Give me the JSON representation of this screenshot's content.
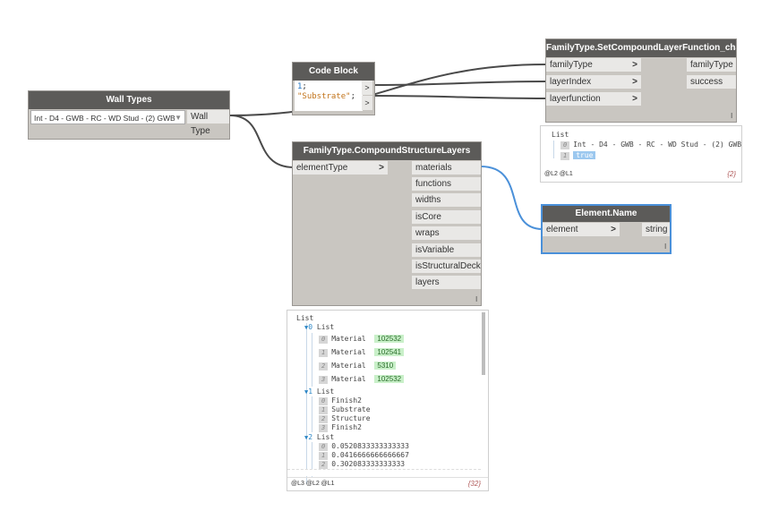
{
  "wall_types": {
    "title": "Wall Types",
    "selected": "Int - D4 - GWB - RC - WD Stud - (2) GWB",
    "output": "Wall Type"
  },
  "code_block": {
    "title": "Code Block",
    "line1": "1",
    "line1_end": ";",
    "line2": "\"Substrate\"",
    "line2_end": ";",
    "out": ">"
  },
  "set_layer_fn": {
    "title": "FamilyType.SetCompoundLayerFunction_chad",
    "inputs": [
      "familyType",
      "layerIndex",
      "layerfunction"
    ],
    "outputs": [
      "familyType",
      "success"
    ],
    "chevron": ">",
    "lacing": "l",
    "preview": {
      "header": "List",
      "row0_idx": "0",
      "row0_text": "Int - D4 - GWB - RC - WD Stud - (2) GWB",
      "row1_idx": "1",
      "row1_text": "true",
      "levels": "@L2 @L1",
      "count": "{2}"
    }
  },
  "compound_layers": {
    "title": "FamilyType.CompoundStructureLayers",
    "input": "elementType",
    "chevron": ">",
    "outputs": [
      "materials",
      "functions",
      "widths",
      "isCore",
      "wraps",
      "isVariable",
      "isStructuralDeck",
      "layers"
    ],
    "lacing": "l"
  },
  "element_name": {
    "title": "Element.Name",
    "input": "element",
    "output": "string",
    "chevron": ">",
    "lacing": "l"
  },
  "big_preview": {
    "root": "List",
    "list_label": "List",
    "list0_idx": "0",
    "list1_idx": "1",
    "list2_idx": "2",
    "materials": [
      {
        "idx": "0",
        "name": "Material",
        "value": "102532"
      },
      {
        "idx": "1",
        "name": "Material",
        "value": "102541"
      },
      {
        "idx": "2",
        "name": "Material",
        "value": "5310"
      },
      {
        "idx": "3",
        "name": "Material",
        "value": "102532"
      }
    ],
    "functions": [
      {
        "idx": "0",
        "name": "Finish2"
      },
      {
        "idx": "1",
        "name": "Substrate"
      },
      {
        "idx": "2",
        "name": "Structure"
      },
      {
        "idx": "3",
        "name": "Finish2"
      }
    ],
    "widths": [
      {
        "idx": "0",
        "name": "0.0520833333333333"
      },
      {
        "idx": "1",
        "name": "0.0416666666666667"
      },
      {
        "idx": "2",
        "name": "0.302083333333333"
      }
    ],
    "levels": "@L3 @L2 @L1",
    "count": "{32}"
  },
  "colors": {
    "node_header": "#5c5b59",
    "node_body": "#c9c6c1",
    "wire": "#4a4a4a",
    "selected_wire": "#4a90d9",
    "value_green": "#c9f0c9"
  }
}
